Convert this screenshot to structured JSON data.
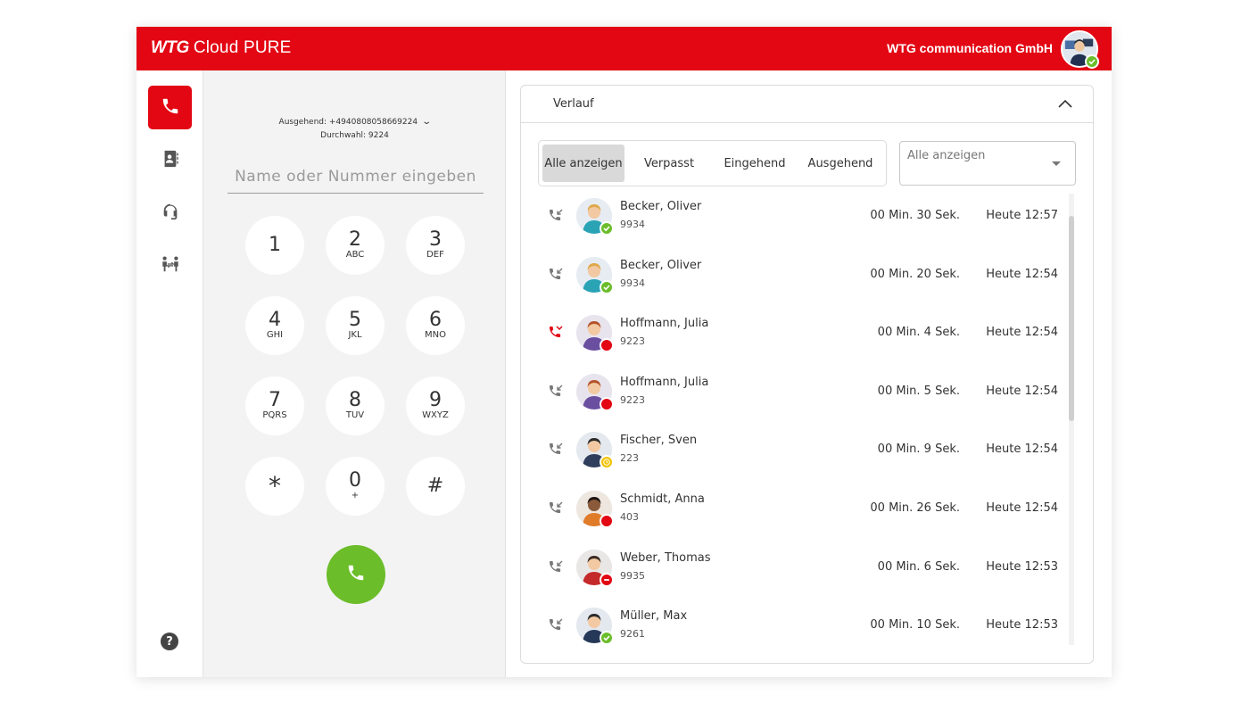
{
  "header": {
    "brand_logo": "WTG",
    "brand_product": "Cloud PURE",
    "company": "WTG communication GmbH",
    "status": "available"
  },
  "sidebar": {
    "items": [
      {
        "icon": "phone-icon",
        "active": true
      },
      {
        "icon": "contacts-icon",
        "active": false
      },
      {
        "icon": "headset-icon",
        "active": false
      },
      {
        "icon": "transfer-icon",
        "active": false
      }
    ],
    "help_icon": "help-icon",
    "help_label": "?"
  },
  "dialer": {
    "outgoing": "Ausgehend: +4940808058669224",
    "direct": "Durchwahl: 9224",
    "input_placeholder": "Name oder Nummer eingeben",
    "keys": [
      {
        "digit": "1",
        "letters": ""
      },
      {
        "digit": "2",
        "letters": "ABC"
      },
      {
        "digit": "3",
        "letters": "DEF"
      },
      {
        "digit": "4",
        "letters": "GHI"
      },
      {
        "digit": "5",
        "letters": "JKL"
      },
      {
        "digit": "6",
        "letters": "MNO"
      },
      {
        "digit": "7",
        "letters": "PQRS"
      },
      {
        "digit": "8",
        "letters": "TUV"
      },
      {
        "digit": "9",
        "letters": "WXYZ"
      },
      {
        "digit": "*",
        "letters": ""
      },
      {
        "digit": "0",
        "letters": "+"
      },
      {
        "digit": "#",
        "letters": ""
      }
    ],
    "call_color": "#6bbd2a"
  },
  "history": {
    "title": "Verlauf",
    "tabs": [
      {
        "label": "Alle anzeigen",
        "active": true
      },
      {
        "label": "Verpasst",
        "active": false
      },
      {
        "label": "Eingehend",
        "active": false
      },
      {
        "label": "Ausgehend",
        "active": false
      }
    ],
    "filter_value": "Alle anzeigen",
    "entries": [
      {
        "name": "Becker, Oliver",
        "ext": "9934",
        "duration": "00 Min. 30 Sek.",
        "time": "Heute 12:57",
        "direction": "incoming",
        "status": "available",
        "avatar": "man-blond"
      },
      {
        "name": "Becker, Oliver",
        "ext": "9934",
        "duration": "00 Min. 20 Sek.",
        "time": "Heute 12:54",
        "direction": "incoming",
        "status": "available",
        "avatar": "man-blond"
      },
      {
        "name": "Hoffmann, Julia",
        "ext": "9223",
        "duration": "00 Min. 4 Sek.",
        "time": "Heute 12:54",
        "direction": "missed",
        "status": "busy",
        "avatar": "woman-red"
      },
      {
        "name": "Hoffmann, Julia",
        "ext": "9223",
        "duration": "00 Min. 5 Sek.",
        "time": "Heute 12:54",
        "direction": "incoming",
        "status": "busy",
        "avatar": "woman-red"
      },
      {
        "name": "Fischer, Sven",
        "ext": "223",
        "duration": "00 Min. 9 Sek.",
        "time": "Heute 12:54",
        "direction": "incoming",
        "status": "away",
        "avatar": "man-headset"
      },
      {
        "name": "Schmidt, Anna",
        "ext": "403",
        "duration": "00 Min. 26 Sek.",
        "time": "Heute 12:54",
        "direction": "incoming",
        "status": "busy",
        "avatar": "woman-dark"
      },
      {
        "name": "Weber, Thomas",
        "ext": "9935",
        "duration": "00 Min. 6 Sek.",
        "time": "Heute 12:53",
        "direction": "incoming",
        "status": "dnd",
        "avatar": "man-red"
      },
      {
        "name": "Müller, Max",
        "ext": "9261",
        "duration": "00 Min. 10 Sek.",
        "time": "Heute 12:53",
        "direction": "incoming",
        "status": "available",
        "avatar": "man-dark"
      }
    ]
  },
  "colors": {
    "brand_red": "#e30613",
    "available": "#6bbd2a",
    "busy": "#e30613",
    "away": "#f2c200"
  }
}
